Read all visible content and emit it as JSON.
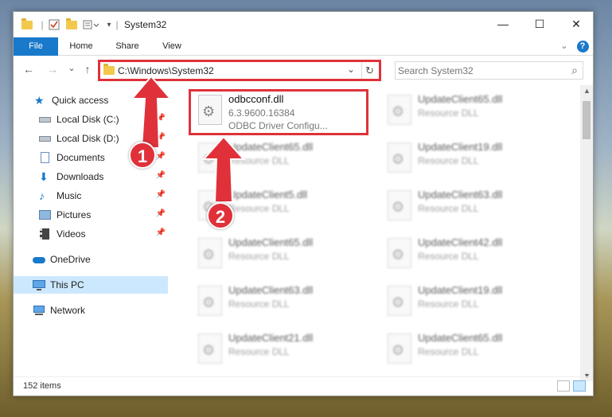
{
  "window": {
    "title": "System32",
    "minimize": "—",
    "maximize": "☐",
    "close": "✕"
  },
  "ribbon": {
    "tabs": [
      "File",
      "Home",
      "Share",
      "View"
    ],
    "expand": "⌄",
    "help": "?"
  },
  "address_bar": {
    "path": "C:\\Windows\\System32",
    "back": "←",
    "forward": "→",
    "recent": "⌄",
    "up": "↑",
    "dropdown": "⌄",
    "refresh": "↻"
  },
  "search": {
    "placeholder": "Search System32",
    "icon": "⌕"
  },
  "nav_pane": {
    "items": [
      {
        "label": "Quick access",
        "icon": "star-icon"
      },
      {
        "label": "Local Disk (C:)",
        "icon": "drive-icon",
        "pinned": true
      },
      {
        "label": "Local Disk (D:)",
        "icon": "drive-icon",
        "pinned": true
      },
      {
        "label": "Documents",
        "icon": "documents-icon",
        "pinned": true
      },
      {
        "label": "Downloads",
        "icon": "download-icon",
        "pinned": true
      },
      {
        "label": "Music",
        "icon": "music-icon",
        "pinned": true
      },
      {
        "label": "Pictures",
        "icon": "pictures-icon",
        "pinned": true
      },
      {
        "label": "Videos",
        "icon": "videos-icon",
        "pinned": true
      },
      {
        "label": "OneDrive",
        "icon": "cloud-icon"
      },
      {
        "label": "This PC",
        "icon": "computer-icon",
        "selected": true
      },
      {
        "label": "Network",
        "icon": "network-icon"
      }
    ],
    "pin_glyph": "📌"
  },
  "files": {
    "highlighted": {
      "name": "odbcconf.dll",
      "version": "6.3.9600.16384",
      "description": "ODBC Driver Configu..."
    },
    "left_column": [
      {
        "name": "UpdateClient65.dll",
        "type": "Resource DLL"
      },
      {
        "name": "UpdateClient5.dll",
        "type": "Resource DLL"
      },
      {
        "name": "UpdateClient65.dll",
        "type": "Resource DLL"
      },
      {
        "name": "UpdateClient63.dll",
        "type": "Resource DLL"
      },
      {
        "name": "UpdateClient21.dll",
        "type": "Resource DLL"
      }
    ],
    "right_column": [
      {
        "name": "UpdateClient65.dll",
        "type": "Resource DLL"
      },
      {
        "name": "UpdateClient19.dll",
        "type": "Resource DLL"
      },
      {
        "name": "UpdateClient63.dll",
        "type": "Resource DLL"
      },
      {
        "name": "UpdateClient42.dll",
        "type": "Resource DLL"
      },
      {
        "name": "UpdateClient19.dll",
        "type": "Resource DLL"
      },
      {
        "name": "UpdateClient65.dll",
        "type": "Resource DLL"
      }
    ]
  },
  "status_bar": {
    "item_count": "152 items"
  },
  "callouts": {
    "step1": "1",
    "step2": "2",
    "color": "#e0313a"
  }
}
